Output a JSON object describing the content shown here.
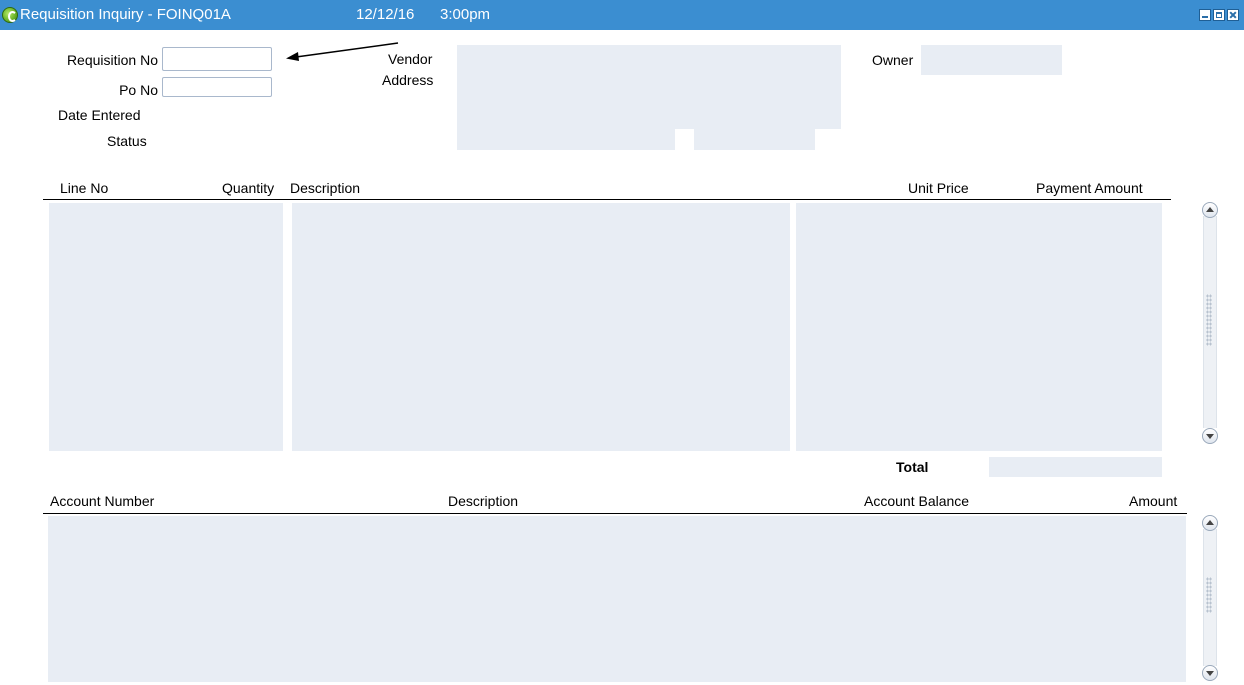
{
  "window": {
    "title": "Requisition Inquiry - FOINQ01A",
    "date": "12/12/16",
    "time": "3:00pm",
    "icon": "app-icon",
    "titlebar_color": "#3b8ed1"
  },
  "header": {
    "requisition_label": "Requisition No",
    "requisition_value": "",
    "po_label": "Po No",
    "po_value": "",
    "date_entered_label": "Date Entered",
    "status_label": "Status",
    "vendor_label": "Vendor",
    "address_label": "Address",
    "owner_label": "Owner"
  },
  "lines": {
    "columns": [
      "Line No",
      "Quantity",
      "Description",
      "Unit Price",
      "Payment Amount"
    ],
    "total_label": "Total"
  },
  "accounts": {
    "columns": [
      "Account Number",
      "Description",
      "Account Balance",
      "Amount"
    ]
  },
  "colors": {
    "field_background": "#e8edf4"
  }
}
